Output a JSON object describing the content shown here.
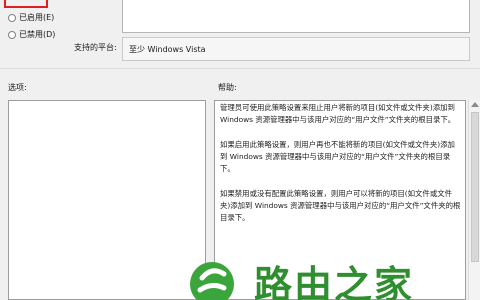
{
  "state": {
    "enabled_label": "已启用(E)",
    "disabled_label": "已禁用(D)"
  },
  "platform": {
    "label": "支持的平台:",
    "value": "至少 Windows Vista"
  },
  "panels": {
    "options_label": "选项:",
    "help_label": "帮助:"
  },
  "help_text": {
    "p1": "管理员可使用此策略设置来阻止用户将新的项目(如文件或文件夹)添加到 Windows 资源管理器中与该用户对应的“用户文件”文件夹的根目录下。",
    "p2": "如果启用此策略设置，则用户再也不能将新的项目(如文件或文件夹)添加到 Windows 资源管理器中与该用户对应的“用户文件”文件夹的根目录下。",
    "p3": "如果禁用或没有配置此策略设置，则用户可以将新的项目(如文件或文件夹)添加到 Windows 资源管理器中与该用户对应的“用户文件”文件夹的根目录下。"
  },
  "watermark": {
    "text": "路由之家"
  }
}
